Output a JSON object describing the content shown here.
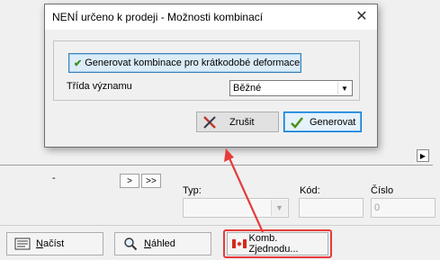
{
  "dialog": {
    "title": "NENÍ určeno k prodeji - Možnosti kombinací",
    "generate_short_term_label": "Generovat kombinace pro krátkodobé deformace",
    "importance_class_label": "Třída významu",
    "importance_class_value": "Běžné",
    "cancel_label": "Zrušit",
    "generate_label": "Generovat"
  },
  "background": {
    "dash": "-",
    "next_label": ">",
    "last_label": ">>",
    "type_label": "Typ:",
    "code_label": "Kód:",
    "number_label": "Číslo",
    "number_value": "0",
    "load_label": "Načíst",
    "preview_label": "Náhled",
    "comb_label": "Komb. Zjednodu..."
  },
  "annotation": {
    "highlight_color": "#e53b3b"
  }
}
